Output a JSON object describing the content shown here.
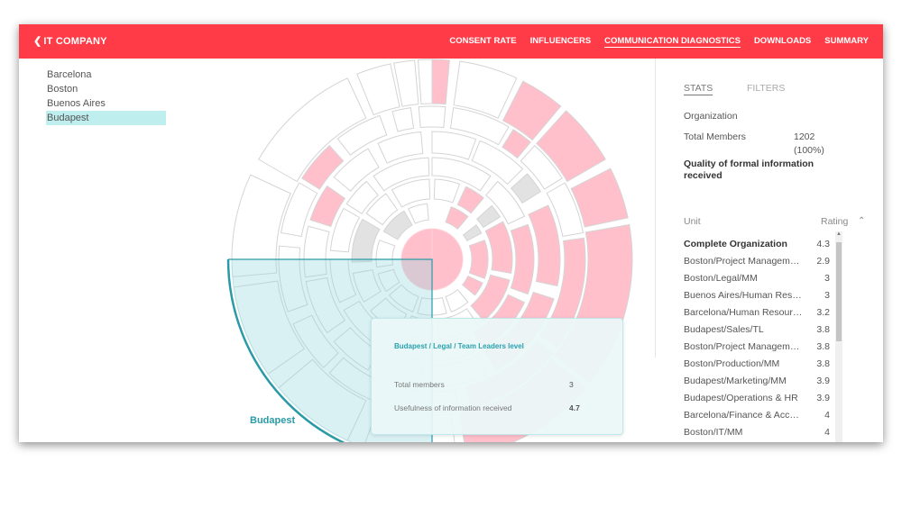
{
  "header": {
    "brand": "IT COMPANY",
    "nav": [
      "CONSENT RATE",
      "INFLUENCERS",
      "COMMUNICATION DIAGNOSTICS",
      "DOWNLOADS",
      "SUMMARY"
    ],
    "active_nav": "COMMUNICATION DIAGNOSTICS"
  },
  "cities": [
    "Barcelona",
    "Boston",
    "Buenos Aires",
    "Budapest"
  ],
  "selected_city": "Budapest",
  "chart_label": "Budapest",
  "tooltip": {
    "title": "Budapest / Legal / Team Leaders level",
    "rows": [
      {
        "label": "Total members",
        "value": "3"
      },
      {
        "label": "Usefulness of information received",
        "value": "4.7"
      }
    ]
  },
  "stats": {
    "tabs": [
      "STATS",
      "FILTERS"
    ],
    "active_tab": "STATS",
    "organization": "Organization",
    "total_members_label": "Total Members",
    "total_members_value": "1202",
    "total_members_pct": "(100%)",
    "quality_title": "Quality of formal information received",
    "unit_header": "Unit",
    "rating_header": "Rating",
    "rows": [
      {
        "unit": "Complete Organization",
        "rating": "4.3"
      },
      {
        "unit": "Boston/Project Management",
        "rating": "2.9"
      },
      {
        "unit": "Boston/Legal/MM",
        "rating": "3"
      },
      {
        "unit": "Buenos Aires/Human Resources",
        "rating": "3"
      },
      {
        "unit": "Barcelona/Human Resources",
        "rating": "3.2"
      },
      {
        "unit": "Budapest/Sales/TL",
        "rating": "3.8"
      },
      {
        "unit": "Boston/Project Management",
        "rating": "3.8"
      },
      {
        "unit": "Boston/Production/MM",
        "rating": "3.8"
      },
      {
        "unit": "Budapest/Marketing/MM",
        "rating": "3.9"
      },
      {
        "unit": "Budapest/Operations & HR",
        "rating": "3.9"
      },
      {
        "unit": "Barcelona/Finance & Accounting",
        "rating": "4"
      },
      {
        "unit": "Boston/IT/MM",
        "rating": "4"
      }
    ]
  },
  "colors": {
    "accent": "#ff3b47",
    "segment_pink": "#ffc0cc",
    "highlight_teal": "#2a9aa6",
    "selection_fill": "#bfeeee"
  }
}
